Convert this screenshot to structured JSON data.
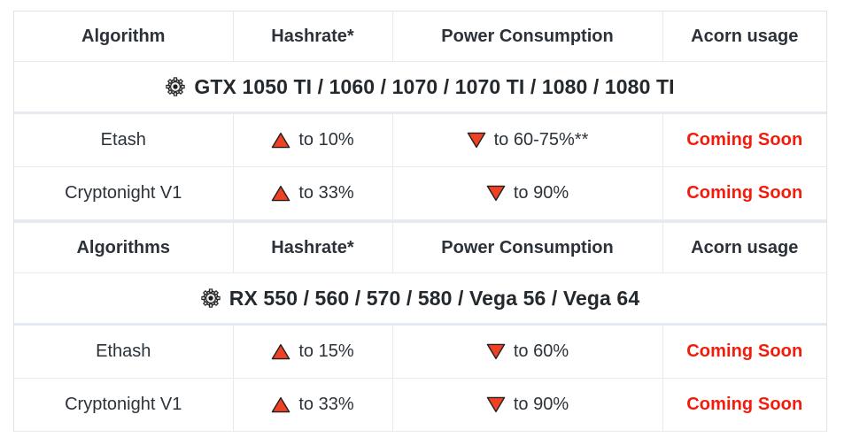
{
  "colors": {
    "accent_red": "#f41b0c",
    "triangle_fill": "#ef4123",
    "triangle_stroke": "#231f20",
    "text": "#2b3239",
    "border": "#e6ebef",
    "divider": "#e4eaef"
  },
  "tables": [
    {
      "id": "nvidia",
      "title": "GTX 1050 TI / 1060 / 1070 / 1070 TI / 1080 / 1080 TI",
      "title_icon": "gear-icon",
      "columns": [
        "Algorithm",
        "Hashrate*",
        "Power Consumption",
        "Acorn usage"
      ],
      "rows": [
        {
          "algorithm": "Etash",
          "hashrate_icon": "triangle-up-icon",
          "hashrate": "to 10%",
          "power_icon": "triangle-down-icon",
          "power": "to 60-75%**",
          "acorn": "Coming Soon"
        },
        {
          "algorithm": "Cryptonight V1",
          "hashrate_icon": "triangle-up-icon",
          "hashrate": "to 33%",
          "power_icon": "triangle-down-icon",
          "power": "to 90%",
          "acorn": "Coming Soon"
        }
      ]
    },
    {
      "id": "amd",
      "title": "RX 550 / 560 / 570 / 580 / Vega 56 / Vega 64",
      "title_icon": "gear-icon",
      "columns": [
        "Algorithms",
        "Hashrate*",
        "Power Consumption",
        "Acorn usage"
      ],
      "rows": [
        {
          "algorithm": "Ethash",
          "hashrate_icon": "triangle-up-icon",
          "hashrate": "to 15%",
          "power_icon": "triangle-down-icon",
          "power": "to 60%",
          "acorn": "Coming Soon"
        },
        {
          "algorithm": "Cryptonight V1",
          "hashrate_icon": "triangle-up-icon",
          "hashrate": "to 33%",
          "power_icon": "triangle-down-icon",
          "power": "to 90%",
          "acorn": "Coming Soon"
        }
      ]
    }
  ]
}
